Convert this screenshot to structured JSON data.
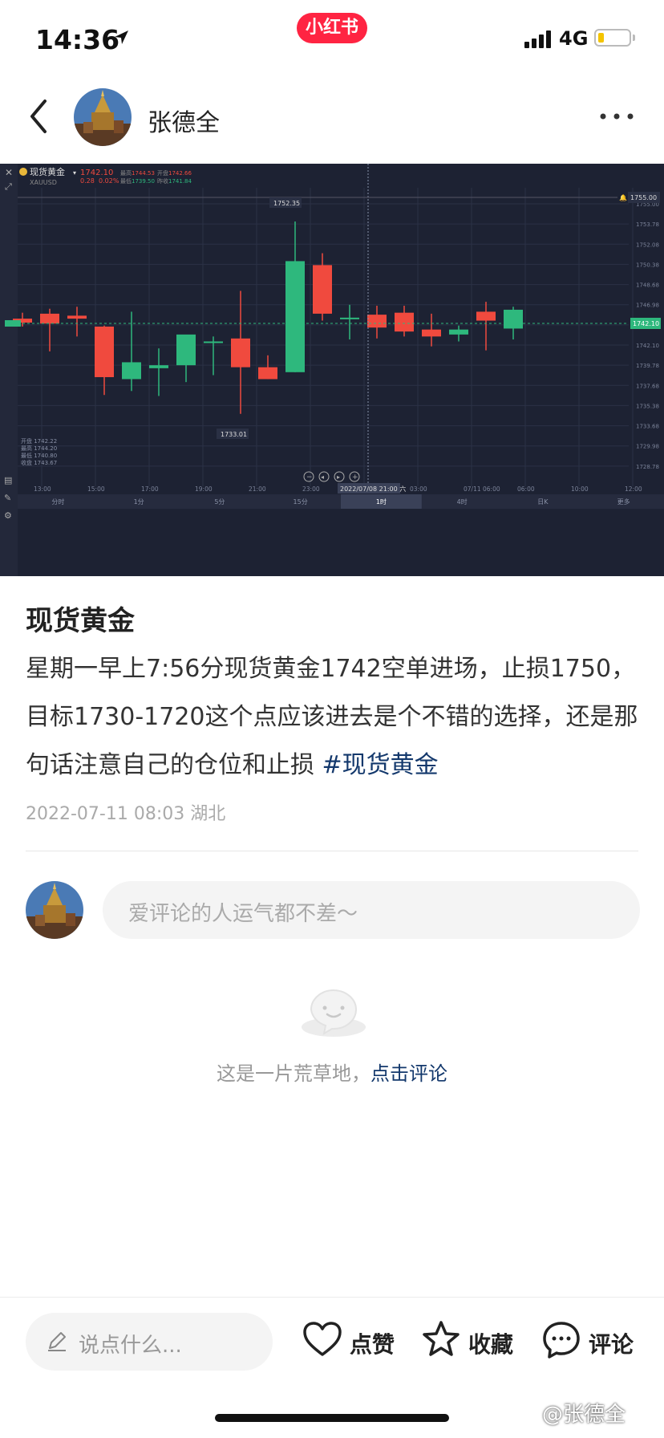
{
  "status_bar": {
    "time": "14:36",
    "app_badge": "小红书",
    "network": "4G",
    "battery_level": 0.2
  },
  "nav": {
    "author_name": "张德全"
  },
  "chart_panel": {
    "symbol": "现货黄金",
    "code": "XAUUSD",
    "last_price": "1742.10",
    "change": "0.28",
    "change_pct": "0.02%",
    "header_fields": [
      {
        "label": "最高",
        "value": "1744.53"
      },
      {
        "label": "开盘",
        "value": "1742.66"
      },
      {
        "label": "最低",
        "value": "1739.50"
      },
      {
        "label": "昨收",
        "value": "1741.84"
      }
    ],
    "ohlc_box": [
      {
        "label": "开盘",
        "value": "1742.22"
      },
      {
        "label": "最高",
        "value": "1744.20"
      },
      {
        "label": "最低",
        "value": "1740.80"
      },
      {
        "label": "收盘",
        "value": "1743.67"
      }
    ],
    "crosshair_label": "2022/07/08 21:00 六",
    "alert_price": "1755.00",
    "current_price_tag": "1742.10",
    "high_label": "1752.35",
    "low_label": "1733.01",
    "timeframes": [
      "分时",
      "1分",
      "5分",
      "15分",
      "1时",
      "4时",
      "日K",
      "更多"
    ],
    "active_timeframe": "1时",
    "colors": {
      "up": "#2eb87d",
      "down": "#f04a3e",
      "bg": "#1d2233"
    }
  },
  "chart_data": {
    "type": "candlestick",
    "x": [
      "13:00",
      "15:00",
      "17:00",
      "19:00",
      "21:00",
      "23:00",
      "2022/07/08 21:00",
      "03:00",
      "07/11 06:00",
      "06:00",
      "10:00",
      "12:00"
    ],
    "x_ticks": [
      "13:00",
      "15:00",
      "17:00",
      "19:00",
      "21:00",
      "23:00",
      "2022/07/08 21:00 六",
      "03:00",
      "07/11 06:00",
      "06:00",
      "10:00",
      "12:00"
    ],
    "y_ticks": [
      "1755.00",
      "1753.78",
      "1752.08",
      "1750.38",
      "1748.68",
      "1746.98",
      "1744.18",
      "1742.10",
      "1739.78",
      "1737.68",
      "1735.38",
      "1733.68",
      "1729.98",
      "1728.78"
    ],
    "ylim": [
      1726.5,
      1755.8
    ],
    "candles": [
      {
        "o": 1742.6,
        "h": 1743.2,
        "l": 1741.8,
        "c": 1742.2
      },
      {
        "o": 1743.1,
        "h": 1743.6,
        "l": 1739.3,
        "c": 1742.1
      },
      {
        "o": 1742.9,
        "h": 1743.8,
        "l": 1740.8,
        "c": 1742.6
      },
      {
        "o": 1741.8,
        "h": 1741.9,
        "l": 1734.9,
        "c": 1736.7
      },
      {
        "o": 1736.5,
        "h": 1743.3,
        "l": 1735.3,
        "c": 1738.2
      },
      {
        "o": 1737.6,
        "h": 1739.6,
        "l": 1734.8,
        "c": 1737.9
      },
      {
        "o": 1737.9,
        "h": 1740.1,
        "l": 1736.2,
        "c": 1741.0
      },
      {
        "o": 1740.2,
        "h": 1740.8,
        "l": 1736.9,
        "c": 1740.3
      },
      {
        "o": 1740.6,
        "h": 1745.4,
        "l": 1733.0,
        "c": 1737.7
      },
      {
        "o": 1737.7,
        "h": 1738.9,
        "l": 1736.5,
        "c": 1736.5
      },
      {
        "o": 1737.2,
        "h": 1752.4,
        "l": 1737.2,
        "c": 1748.4
      },
      {
        "o": 1748.0,
        "h": 1749.2,
        "l": 1742.4,
        "c": 1743.1
      },
      {
        "o": 1742.6,
        "h": 1744.0,
        "l": 1740.5,
        "c": 1742.7
      },
      {
        "o": 1743.0,
        "h": 1743.9,
        "l": 1740.6,
        "c": 1741.7
      },
      {
        "o": 1743.2,
        "h": 1743.9,
        "l": 1740.8,
        "c": 1741.3
      },
      {
        "o": 1741.5,
        "h": 1743.1,
        "l": 1739.8,
        "c": 1740.8
      },
      {
        "o": 1741.0,
        "h": 1741.9,
        "l": 1740.3,
        "c": 1741.5
      },
      {
        "o": 1743.3,
        "h": 1744.3,
        "l": 1739.4,
        "c": 1742.4
      },
      {
        "o": 1741.6,
        "h": 1743.8,
        "l": 1740.5,
        "c": 1743.5
      }
    ]
  },
  "post": {
    "title": "现货黄金",
    "body": "星期一早上7:56分现货黄金1742空单进场，止损1750，目标1730-1720这个点应该进去是个不错的选择，还是那句话注意自己的仓位和止损 ",
    "hashtag": "#现货黄金",
    "meta": "2022-07-11 08:03 湖北"
  },
  "comments": {
    "placeholder": "爱评论的人运气都不差～",
    "empty_text": "这是一片荒草地，",
    "empty_link": "点击评论"
  },
  "bottom_bar": {
    "input_placeholder": "说点什么...",
    "like_label": "点赞",
    "collect_label": "收藏",
    "comment_label": "评论"
  },
  "watermark": "@张德全"
}
